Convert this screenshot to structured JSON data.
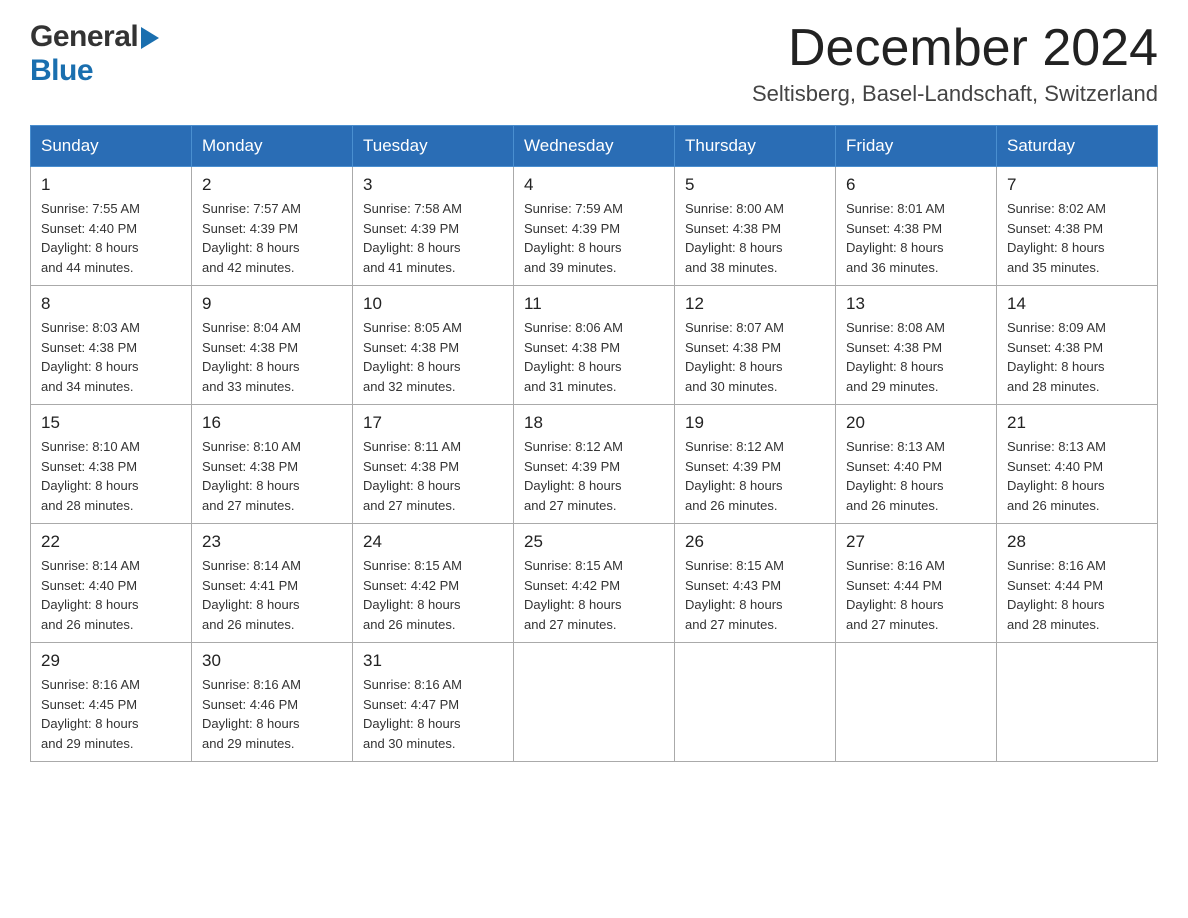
{
  "header": {
    "logo_general": "General",
    "logo_blue": "Blue",
    "month_title": "December 2024",
    "location": "Seltisberg, Basel-Landschaft, Switzerland"
  },
  "days_of_week": [
    "Sunday",
    "Monday",
    "Tuesday",
    "Wednesday",
    "Thursday",
    "Friday",
    "Saturday"
  ],
  "weeks": [
    [
      {
        "day": "1",
        "sunrise": "7:55 AM",
        "sunset": "4:40 PM",
        "daylight": "8 hours and 44 minutes."
      },
      {
        "day": "2",
        "sunrise": "7:57 AM",
        "sunset": "4:39 PM",
        "daylight": "8 hours and 42 minutes."
      },
      {
        "day": "3",
        "sunrise": "7:58 AM",
        "sunset": "4:39 PM",
        "daylight": "8 hours and 41 minutes."
      },
      {
        "day": "4",
        "sunrise": "7:59 AM",
        "sunset": "4:39 PM",
        "daylight": "8 hours and 39 minutes."
      },
      {
        "day": "5",
        "sunrise": "8:00 AM",
        "sunset": "4:38 PM",
        "daylight": "8 hours and 38 minutes."
      },
      {
        "day": "6",
        "sunrise": "8:01 AM",
        "sunset": "4:38 PM",
        "daylight": "8 hours and 36 minutes."
      },
      {
        "day": "7",
        "sunrise": "8:02 AM",
        "sunset": "4:38 PM",
        "daylight": "8 hours and 35 minutes."
      }
    ],
    [
      {
        "day": "8",
        "sunrise": "8:03 AM",
        "sunset": "4:38 PM",
        "daylight": "8 hours and 34 minutes."
      },
      {
        "day": "9",
        "sunrise": "8:04 AM",
        "sunset": "4:38 PM",
        "daylight": "8 hours and 33 minutes."
      },
      {
        "day": "10",
        "sunrise": "8:05 AM",
        "sunset": "4:38 PM",
        "daylight": "8 hours and 32 minutes."
      },
      {
        "day": "11",
        "sunrise": "8:06 AM",
        "sunset": "4:38 PM",
        "daylight": "8 hours and 31 minutes."
      },
      {
        "day": "12",
        "sunrise": "8:07 AM",
        "sunset": "4:38 PM",
        "daylight": "8 hours and 30 minutes."
      },
      {
        "day": "13",
        "sunrise": "8:08 AM",
        "sunset": "4:38 PM",
        "daylight": "8 hours and 29 minutes."
      },
      {
        "day": "14",
        "sunrise": "8:09 AM",
        "sunset": "4:38 PM",
        "daylight": "8 hours and 28 minutes."
      }
    ],
    [
      {
        "day": "15",
        "sunrise": "8:10 AM",
        "sunset": "4:38 PM",
        "daylight": "8 hours and 28 minutes."
      },
      {
        "day": "16",
        "sunrise": "8:10 AM",
        "sunset": "4:38 PM",
        "daylight": "8 hours and 27 minutes."
      },
      {
        "day": "17",
        "sunrise": "8:11 AM",
        "sunset": "4:38 PM",
        "daylight": "8 hours and 27 minutes."
      },
      {
        "day": "18",
        "sunrise": "8:12 AM",
        "sunset": "4:39 PM",
        "daylight": "8 hours and 27 minutes."
      },
      {
        "day": "19",
        "sunrise": "8:12 AM",
        "sunset": "4:39 PM",
        "daylight": "8 hours and 26 minutes."
      },
      {
        "day": "20",
        "sunrise": "8:13 AM",
        "sunset": "4:40 PM",
        "daylight": "8 hours and 26 minutes."
      },
      {
        "day": "21",
        "sunrise": "8:13 AM",
        "sunset": "4:40 PM",
        "daylight": "8 hours and 26 minutes."
      }
    ],
    [
      {
        "day": "22",
        "sunrise": "8:14 AM",
        "sunset": "4:40 PM",
        "daylight": "8 hours and 26 minutes."
      },
      {
        "day": "23",
        "sunrise": "8:14 AM",
        "sunset": "4:41 PM",
        "daylight": "8 hours and 26 minutes."
      },
      {
        "day": "24",
        "sunrise": "8:15 AM",
        "sunset": "4:42 PM",
        "daylight": "8 hours and 26 minutes."
      },
      {
        "day": "25",
        "sunrise": "8:15 AM",
        "sunset": "4:42 PM",
        "daylight": "8 hours and 27 minutes."
      },
      {
        "day": "26",
        "sunrise": "8:15 AM",
        "sunset": "4:43 PM",
        "daylight": "8 hours and 27 minutes."
      },
      {
        "day": "27",
        "sunrise": "8:16 AM",
        "sunset": "4:44 PM",
        "daylight": "8 hours and 27 minutes."
      },
      {
        "day": "28",
        "sunrise": "8:16 AM",
        "sunset": "4:44 PM",
        "daylight": "8 hours and 28 minutes."
      }
    ],
    [
      {
        "day": "29",
        "sunrise": "8:16 AM",
        "sunset": "4:45 PM",
        "daylight": "8 hours and 29 minutes."
      },
      {
        "day": "30",
        "sunrise": "8:16 AM",
        "sunset": "4:46 PM",
        "daylight": "8 hours and 29 minutes."
      },
      {
        "day": "31",
        "sunrise": "8:16 AM",
        "sunset": "4:47 PM",
        "daylight": "8 hours and 30 minutes."
      },
      null,
      null,
      null,
      null
    ]
  ]
}
